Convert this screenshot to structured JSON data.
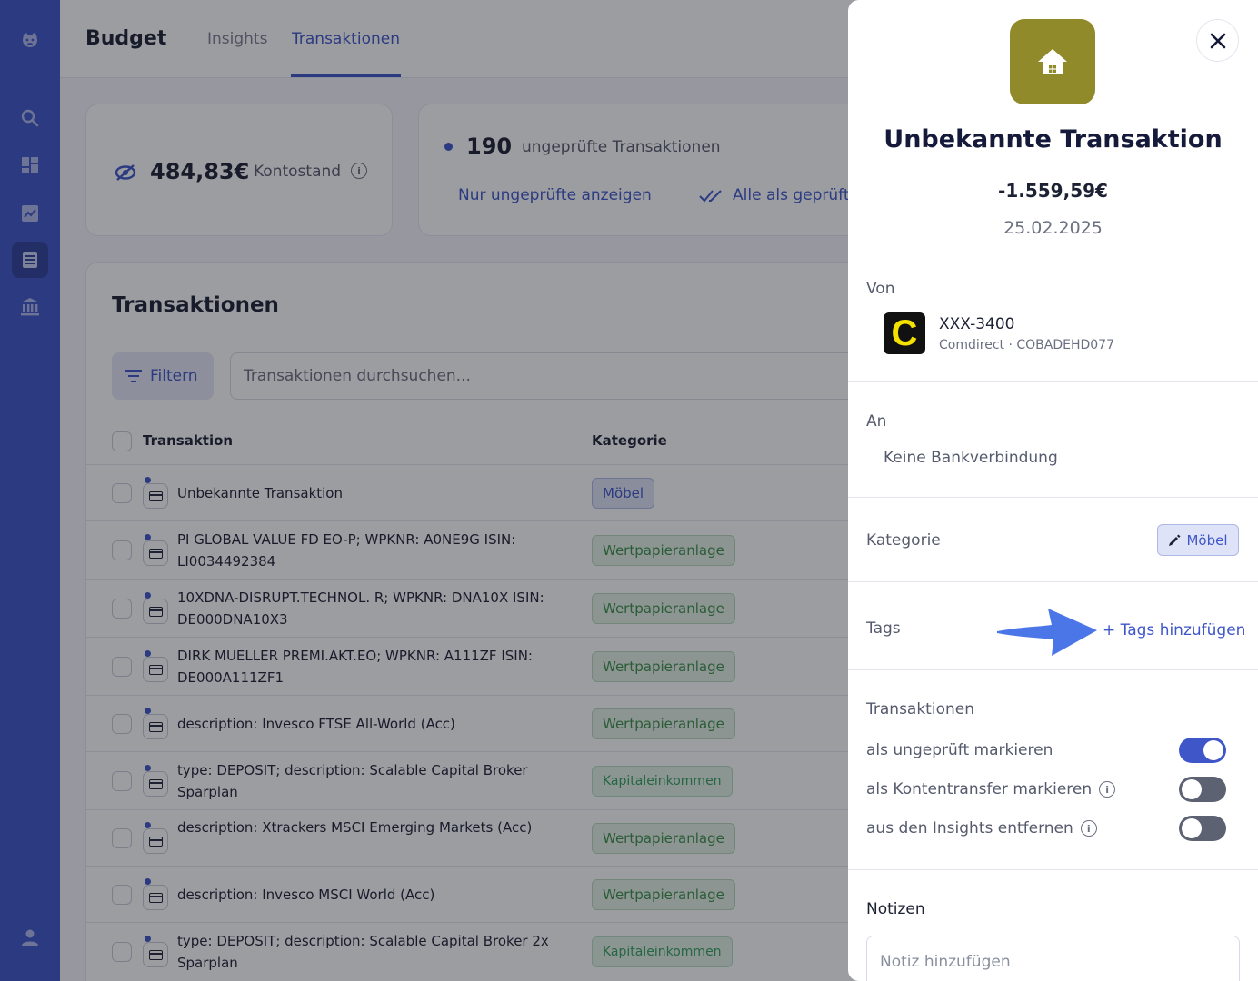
{
  "nav": {
    "items": [
      "logo",
      "search",
      "dashboard",
      "insights",
      "transactions",
      "banks",
      "profile"
    ]
  },
  "header": {
    "brand": "Budget",
    "tabs": [
      {
        "label": "Insights",
        "active": false
      },
      {
        "label": "Transaktionen",
        "active": true
      }
    ]
  },
  "balance_card": {
    "amount": "484,83€",
    "label": "Kontostand"
  },
  "review_card": {
    "count": "190",
    "label": "ungeprüfte Transaktionen",
    "show_unchecked": "Nur ungeprüfte anzeigen",
    "mark_all": "Alle als geprüft"
  },
  "transactions": {
    "title": "Transaktionen",
    "filter_label": "Filtern",
    "search_placeholder": "Transaktionen durchsuchen...",
    "col_transaction": "Transaktion",
    "col_category": "Kategorie",
    "rows": [
      {
        "name": "Unbekannte Transaktion",
        "category": "Möbel",
        "type": "moebel"
      },
      {
        "name": "PI GLOBAL VALUE FD EO-P; WPKNR: A0NE9G ISIN: LI0034492384",
        "category": "Wertpapieranlage",
        "type": "wert"
      },
      {
        "name": "10XDNA-DISRUPT.TECHNOL. R; WPKNR: DNA10X ISIN: DE000DNA10X3",
        "category": "Wertpapieranlage",
        "type": "wert"
      },
      {
        "name": "DIRK MUELLER PREMI.AKT.EO; WPKNR: A111ZF ISIN: DE000A111ZF1",
        "category": "Wertpapieranlage",
        "type": "wert"
      },
      {
        "name": "description: Invesco FTSE All-World (Acc)",
        "category": "Wertpapieranlage",
        "type": "wert"
      },
      {
        "name": "type: DEPOSIT; description: Scalable Capital Broker Sparplan",
        "category": "Kapitaleinkommen",
        "type": "kapital"
      },
      {
        "name": "description: Xtrackers MSCI Emerging Markets (Acc)",
        "category": "Wertpapieranlage",
        "type": "wert"
      },
      {
        "name": "description: Invesco MSCI World (Acc)",
        "category": "Wertpapieranlage",
        "type": "wert"
      },
      {
        "name": "type: DEPOSIT; description: Scalable Capital Broker 2x Sparplan",
        "category": "Kapitaleinkommen",
        "type": "kapital"
      }
    ]
  },
  "drawer": {
    "title": "Unbekannte Transaktion",
    "amount": "-1.559,59€",
    "date": "25.02.2025",
    "icon_color": "#918a2a",
    "from_label": "Von",
    "from_account": "XXX-3400",
    "from_bank": "Comdirect · COBADEHD077",
    "to_label": "An",
    "to_value": "Keine Bankverbindung",
    "category_label": "Kategorie",
    "category_value": "Möbel",
    "tags_label": "Tags",
    "tags_add": "+ Tags hinzufügen",
    "tx_section": "Transaktionen",
    "toggles": [
      {
        "label": "als ungeprüft markieren",
        "on": true,
        "info": false
      },
      {
        "label": "als Kontentransfer markieren",
        "on": false,
        "info": true
      },
      {
        "label": "aus den Insights entfernen",
        "on": false,
        "info": true
      }
    ],
    "notes_label": "Notizen",
    "notes_placeholder": "Notiz hinzufügen"
  },
  "colors": {
    "accent": "#3f56c9",
    "sidebar": "#3f56c9",
    "house_tile": "#918a2a",
    "arrow": "#4a76e8"
  }
}
